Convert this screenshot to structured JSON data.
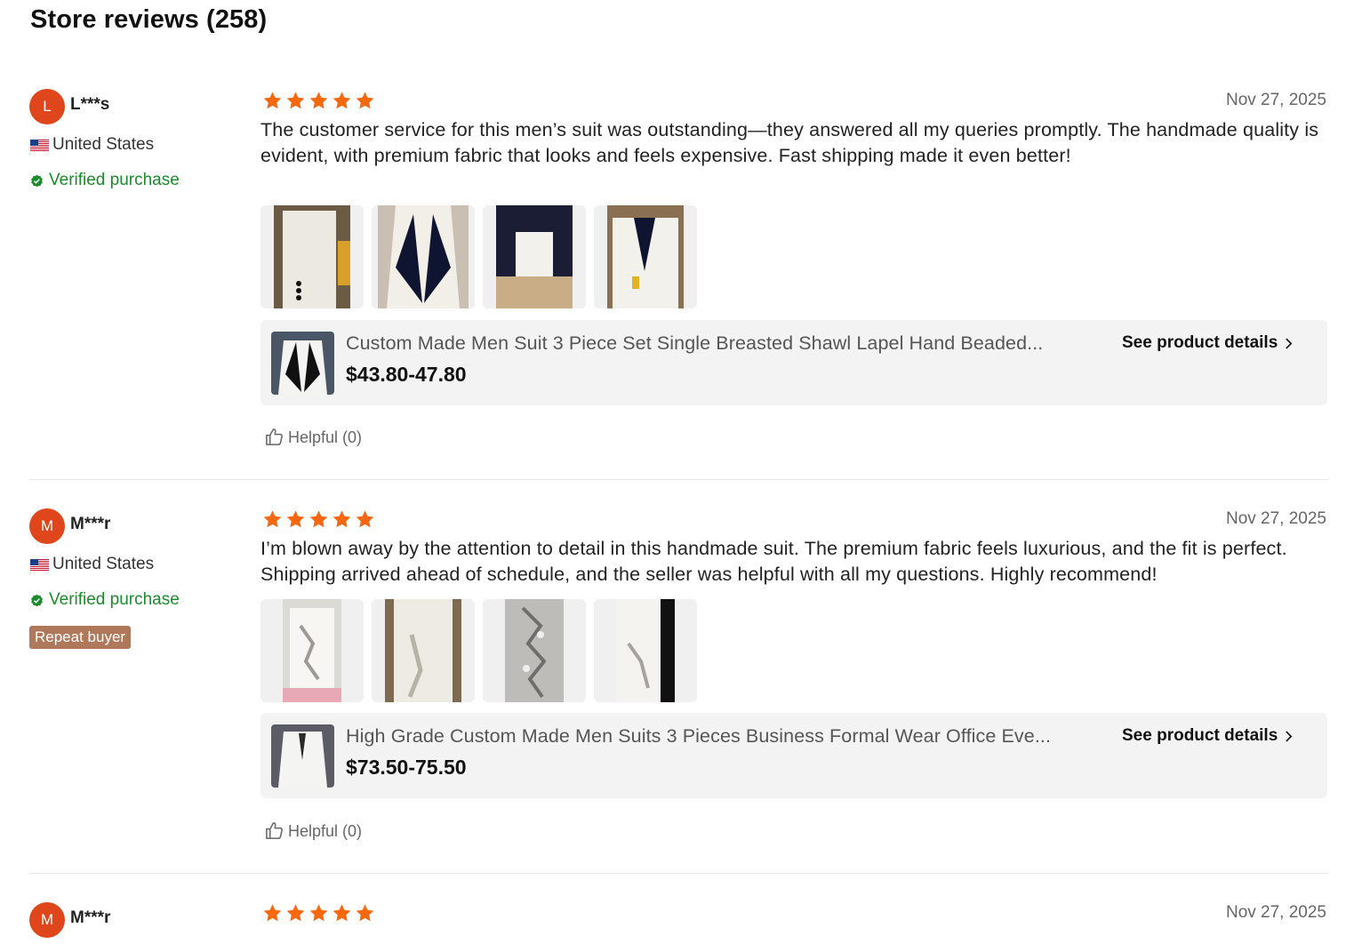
{
  "page": {
    "title": "Store reviews (258)"
  },
  "colors": {
    "star": "#f7680f",
    "verified": "#1b8a2a",
    "avatar": "#e0461c",
    "repeat_badge": "#b0785a"
  },
  "icons": {
    "star": "star-icon",
    "flag": "us-flag-icon",
    "verified": "verified-check-icon",
    "thumb": "thumbs-up-icon",
    "chevron": "chevron-right-icon"
  },
  "reviews": [
    {
      "initial": "L",
      "name": "L***s",
      "country": "United States",
      "verified_label": "Verified purchase",
      "rating": 5,
      "date": "Nov 27, 2025",
      "text": "The customer service for this men’s suit was outstanding—they answered all my queries promptly. The handmade quality is evident, with premium fabric that looks and feels expensive. Fast shipping made it even better!",
      "product": {
        "title": "Custom Made Men Suit 3 Piece Set Single Breasted Shawl Lapel Hand Beaded...",
        "price": "$43.80-47.80",
        "link_label": "See product details"
      },
      "helpful_label": "Helpful (0)"
    },
    {
      "initial": "M",
      "name": "M***r",
      "country": "United States",
      "verified_label": "Verified purchase",
      "badge": "Repeat buyer",
      "rating": 5,
      "date": "Nov 27, 2025",
      "text": "I’m blown away by the attention to detail in this handmade suit. The premium fabric feels luxurious, and the fit is perfect. Shipping arrived ahead of schedule, and the seller was helpful with all my questions. Highly recommend!",
      "product": {
        "title": "High Grade Custom Made Men Suits 3 Pieces Business Formal Wear Office Eve...",
        "price": "$73.50-75.50",
        "link_label": "See product details"
      },
      "helpful_label": "Helpful (0)"
    },
    {
      "initial": "M",
      "name": "M***r",
      "rating": 5,
      "date": "Nov 27, 2025"
    }
  ]
}
